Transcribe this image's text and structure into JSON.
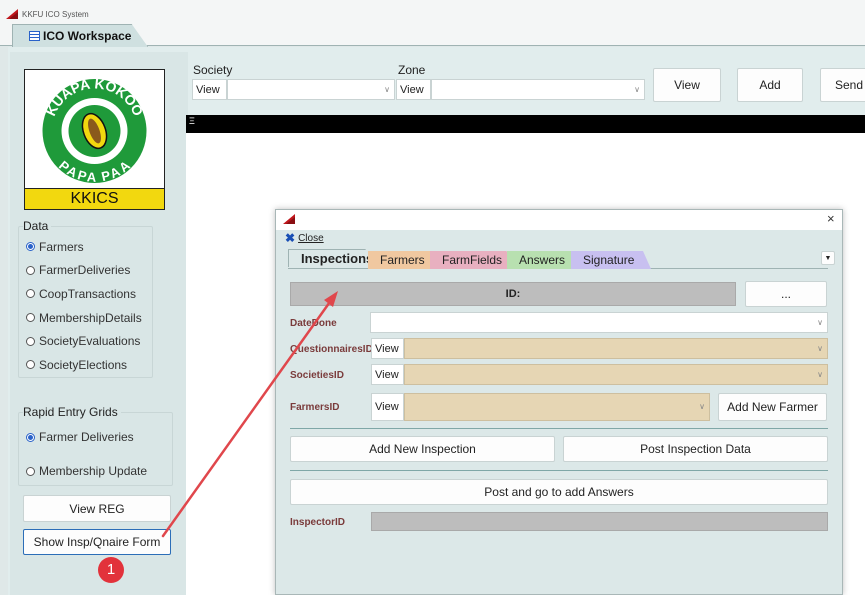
{
  "app": {
    "title": "KKFU ICO System"
  },
  "workspace_tab": {
    "label": "ICO Workspace"
  },
  "logo": {
    "top_text": "KUAPA KOKOO",
    "bottom_text": "PAPA PAA",
    "caption": "KKICS"
  },
  "data_group": {
    "title": "Data",
    "items": [
      "Farmers",
      "FarmerDeliveries",
      "CoopTransactions",
      "MembershipDetails",
      "SocietyEvaluations",
      "SocietyElections"
    ],
    "selected": "Farmers"
  },
  "rapid_group": {
    "title": "Rapid Entry Grids",
    "items": [
      "Farmer Deliveries",
      "Membership Update"
    ],
    "selected": "Farmer Deliveries"
  },
  "left_buttons": {
    "view_reg": "View REG",
    "show_form": "Show Insp/Qnaire Form"
  },
  "filters": {
    "society_label": "Society",
    "zone_label": "Zone",
    "view": "View",
    "society_value": "",
    "zone_value": ""
  },
  "top_buttons": {
    "view": "View",
    "add": "Add",
    "send": "Send U"
  },
  "grid_marker": "Ξ",
  "dialog": {
    "close_label": "Close",
    "tabs": [
      "Inspections",
      "Farmers",
      "FarmFields",
      "Answers",
      "Signature"
    ],
    "active_tab": "Inspections",
    "id_label": "ID:",
    "ellipsis": "...",
    "fields": {
      "date_done": "DateDone",
      "questionnaires_id": "QuestionnairesID",
      "societies_id": "SocietiesID",
      "farmers_id": "FarmersID",
      "inspector_id": "InspectorID"
    },
    "view": "View",
    "buttons": {
      "add_new_farmer": "Add New Farmer",
      "add_new_inspection": "Add New Inspection",
      "post_inspection_data": "Post Inspection Data",
      "post_and_answers": "Post and go to add Answers"
    }
  },
  "annotation": {
    "step": "1"
  },
  "colors": {
    "accent": "#2a62c9",
    "arrow": "#e0474c",
    "tab_farmers": "#f0c8a0",
    "tab_farmfields": "#e8b0c0",
    "tab_answers": "#b8e0b0",
    "tab_signature": "#c8c0f0"
  }
}
